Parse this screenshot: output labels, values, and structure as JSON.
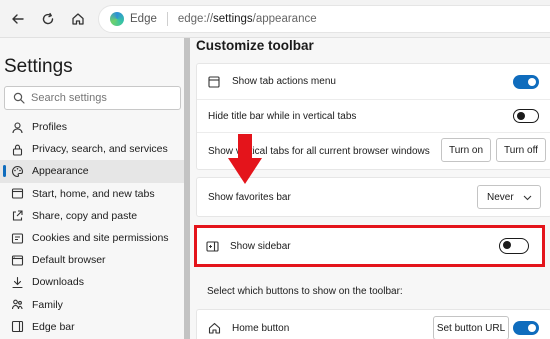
{
  "browser": {
    "origin_label": "Edge",
    "url_prefix": "edge://",
    "url_main": "settings",
    "url_suffix": "/appearance"
  },
  "sidebar": {
    "title": "Settings",
    "search_placeholder": "Search settings",
    "items": [
      {
        "label": "Profiles",
        "icon": "profile-icon"
      },
      {
        "label": "Privacy, search, and services",
        "icon": "lock-icon"
      },
      {
        "label": "Appearance",
        "icon": "appearance-icon",
        "active": true
      },
      {
        "label": "Start, home, and new tabs",
        "icon": "home-tabs-icon"
      },
      {
        "label": "Share, copy and paste",
        "icon": "share-icon"
      },
      {
        "label": "Cookies and site permissions",
        "icon": "cookies-icon"
      },
      {
        "label": "Default browser",
        "icon": "browser-icon"
      },
      {
        "label": "Downloads",
        "icon": "download-icon"
      },
      {
        "label": "Family",
        "icon": "family-icon"
      },
      {
        "label": "Edge bar",
        "icon": "edge-bar-icon"
      }
    ]
  },
  "main": {
    "section_title": "Customize toolbar",
    "rows": {
      "tab_actions": {
        "label": "Show tab actions menu",
        "toggle": "on"
      },
      "hide_title_bar": {
        "label": "Hide title bar while in vertical tabs",
        "toggle": "off"
      },
      "vertical_tabs": {
        "label": "Show vertical tabs for all current browser windows",
        "turn_on": "Turn on",
        "turn_off": "Turn off"
      },
      "favorites_bar": {
        "label": "Show favorites bar",
        "value": "Never"
      },
      "sidebar": {
        "label": "Show sidebar",
        "toggle": "off"
      },
      "select_buttons": {
        "label": "Select which buttons to show on the toolbar:"
      },
      "home_button": {
        "label": "Home button",
        "set_url": "Set button URL",
        "toggle": "on"
      }
    }
  },
  "annotation": {
    "arrow_color": "#e4141b",
    "box_color": "#e4141b"
  },
  "colors": {
    "accent": "#0f6cbd"
  }
}
